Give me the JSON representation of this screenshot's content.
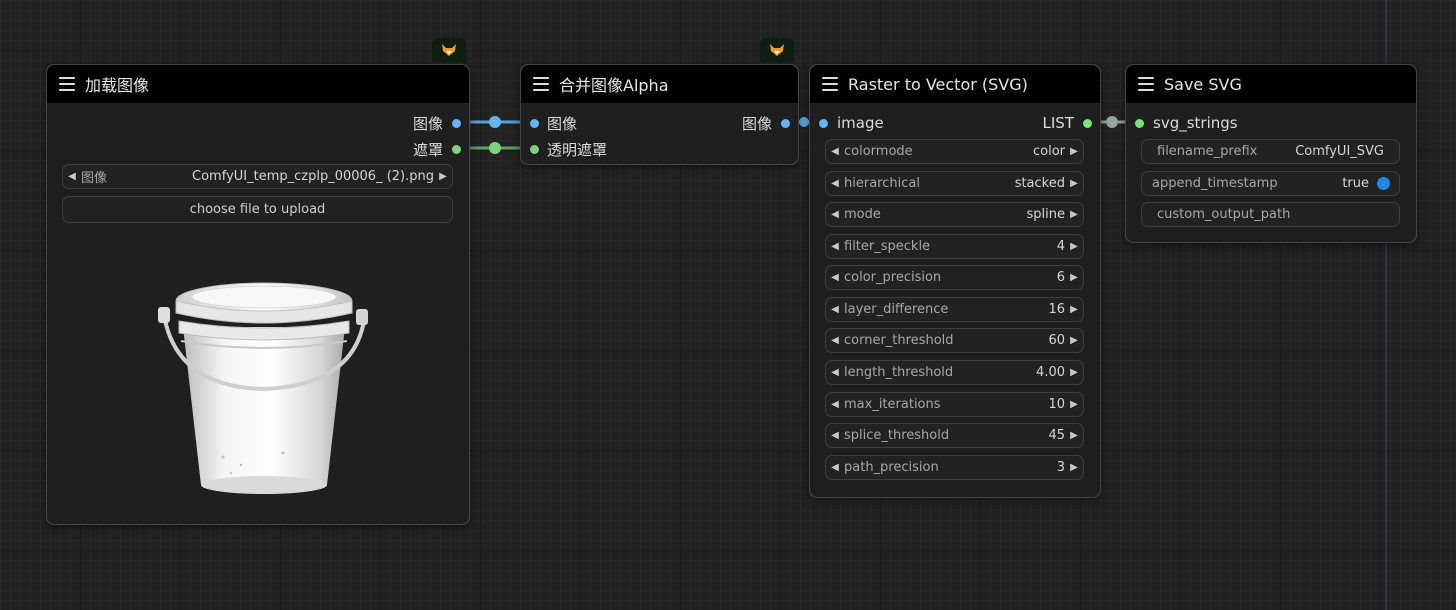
{
  "nodes": {
    "load_image": {
      "title": "加载图像",
      "outputs": [
        "图像",
        "遮罩"
      ],
      "image_widget": {
        "label": "图像",
        "value": "ComfyUI_temp_czplp_00006_ (2).png"
      },
      "upload_button": "choose file to upload",
      "preview_icon": "white-bucket-image"
    },
    "merge_alpha": {
      "title": "合并图像Alpha",
      "inputs": [
        "图像",
        "透明遮罩"
      ],
      "outputs": [
        "图像"
      ],
      "badge_icon": "fox-icon"
    },
    "raster_to_vector": {
      "title": "Raster to Vector (SVG)",
      "inputs": [
        "image"
      ],
      "outputs": [
        "LIST"
      ],
      "badge_icon": "fox-icon",
      "widgets": [
        {
          "label": "colormode",
          "value": "color"
        },
        {
          "label": "hierarchical",
          "value": "stacked"
        },
        {
          "label": "mode",
          "value": "spline"
        },
        {
          "label": "filter_speckle",
          "value": "4"
        },
        {
          "label": "color_precision",
          "value": "6"
        },
        {
          "label": "layer_difference",
          "value": "16"
        },
        {
          "label": "corner_threshold",
          "value": "60"
        },
        {
          "label": "length_threshold",
          "value": "4.00"
        },
        {
          "label": "max_iterations",
          "value": "10"
        },
        {
          "label": "splice_threshold",
          "value": "45"
        },
        {
          "label": "path_precision",
          "value": "3"
        }
      ]
    },
    "save_svg": {
      "title": "Save SVG",
      "inputs": [
        "svg_strings"
      ],
      "widgets": [
        {
          "label": "filename_prefix",
          "value": "ComfyUI_SVG"
        },
        {
          "label": "append_timestamp",
          "value": "true"
        },
        {
          "label": "custom_output_path",
          "value": ""
        }
      ]
    }
  },
  "colors": {
    "image_link": "#64b5f6",
    "mask_link": "#7ed47e",
    "list_link": "#9aa89a",
    "toggle_on": "#1e88e5",
    "badge_bg": "#0e1f12"
  }
}
